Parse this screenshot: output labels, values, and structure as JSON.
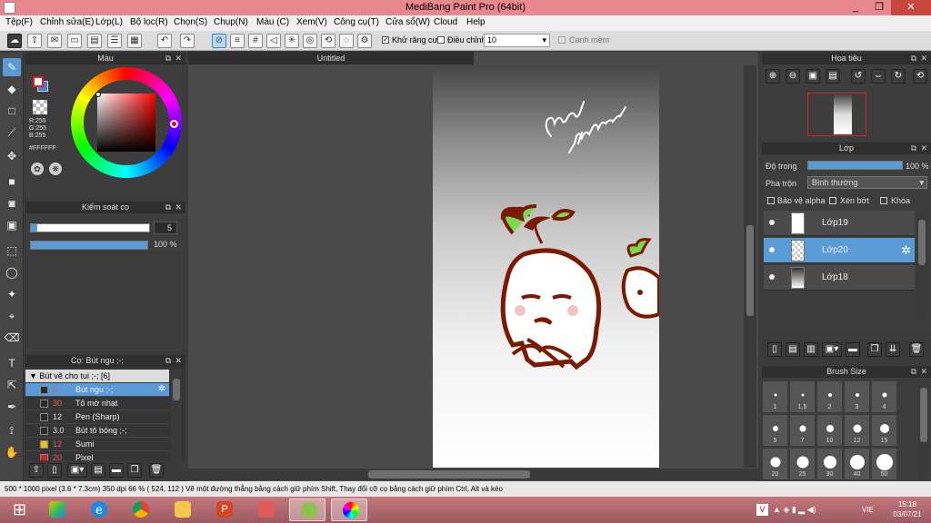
{
  "window": {
    "title": "MediBang Paint Pro (64bit)",
    "minimize": "_",
    "maximize": "❐",
    "close": "✕"
  },
  "menu": [
    "Tệp(F)",
    "Chỉnh sửa(E)",
    "Lớp(L)",
    "Bộ lọc(R)",
    "Chọn(S)",
    "Chụp(N)",
    "Màu (C)",
    "Xem(V)",
    "Công cụ(T)",
    "Cửa sổ(W)",
    "Cloud",
    "Help"
  ],
  "toolbar": {
    "antialias_label": "Khử răng cưa",
    "antialias_checked": true,
    "adjust_label": "Điều chỉnh",
    "adjust_value": "10",
    "snap_label": "Canh mềm",
    "snap_checked": false
  },
  "color_panel": {
    "title": "Màu",
    "rgb": [
      "R:255",
      "G:255",
      "B:255"
    ],
    "hex": "#FFFFFF",
    "main_color": "#ffffff",
    "sub_color": "#4a7fc1",
    "fg_outline": "#e02020"
  },
  "brush_control": {
    "title": "Kiểm soát cọ",
    "size_value": "5",
    "opacity_value": "100 %",
    "size_fraction": 0.05,
    "opacity_fraction": 1.0
  },
  "brush_panel": {
    "title": "Cọ: Bút ngu ;-;",
    "group": "Bút vẽ cho tui ;-; [6]",
    "items": [
      {
        "size": "5",
        "name": "Bút ngu ;-;",
        "color": "#2a2a2a",
        "size_color": "#e05a5a",
        "selected": true
      },
      {
        "size": "30",
        "name": "Tô mờ nhạt",
        "color": "#2a2a2a",
        "size_color": "#e05a5a",
        "selected": false
      },
      {
        "size": "12",
        "name": "Pen (Sharp)",
        "color": "#2a2a2a",
        "size_color": "#dddddd",
        "selected": false
      },
      {
        "size": "3.0",
        "name": "Bút tô bóng ;-;",
        "color": "#2a2a2a",
        "size_color": "#dddddd",
        "selected": false
      },
      {
        "size": "12",
        "name": "Sumi",
        "color": "#e8c11c",
        "size_color": "#e05a5a",
        "selected": false
      },
      {
        "size": "20",
        "name": "Pixel",
        "color": "#d92020",
        "size_color": "#e05a5a",
        "selected": false
      }
    ]
  },
  "document": {
    "tab_title": "Untitled"
  },
  "navigator": {
    "title": "Hoa tiêu"
  },
  "layers_panel": {
    "title": "Lớp",
    "opacity_label": "Độ trong",
    "opacity_value": "100 %",
    "opacity_fraction": 1.0,
    "blend_label": "Pha trộn",
    "blend_value": "Bình thường",
    "checks": [
      "Bảo vệ alpha",
      "Xén bớt",
      "Khóa"
    ],
    "layers": [
      {
        "name": "Lớp19",
        "selected": false
      },
      {
        "name": "Lớp20",
        "selected": true
      },
      {
        "name": "Lớp18",
        "selected": false
      }
    ]
  },
  "brush_size_panel": {
    "title": "Brush Size",
    "sizes": [
      "1",
      "1.5",
      "2",
      "3",
      "4",
      "5",
      "7",
      "10",
      "12",
      "15",
      "20",
      "25",
      "30",
      "40",
      "50"
    ]
  },
  "status_bar": {
    "text": "500 * 1000 pixel  (3.6 * 7.3cm)  350 dpi  66 %  ( 524, 112 )  Vẽ một đường thẳng bằng cách giữ phím Shift, Thay đổi cỡ cọ bằng cách giữ phím Ctrl, Alt và kéo"
  },
  "taskbar": {
    "lang": "VIE",
    "time": "15:18",
    "date": "03/07/21"
  }
}
